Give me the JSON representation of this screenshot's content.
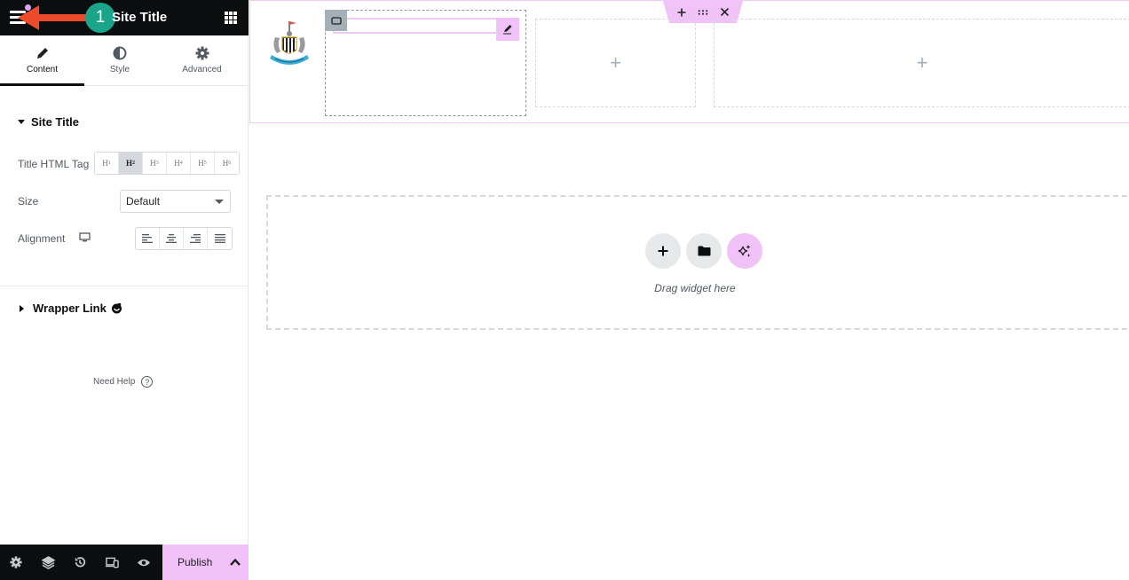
{
  "panel": {
    "title": "Site Title",
    "annotation_step": "1",
    "tabs": [
      {
        "label": "Content",
        "icon": "pencil-icon",
        "active": true
      },
      {
        "label": "Style",
        "icon": "half-circle-icon",
        "active": false
      },
      {
        "label": "Advanced",
        "icon": "gear-icon",
        "active": false
      }
    ],
    "section_site_title": {
      "heading": "Site Title",
      "title_html_tag_label": "Title HTML Tag",
      "tags": [
        "H1",
        "H2",
        "H3",
        "H4",
        "H5",
        "H6"
      ],
      "selected_tag": "H2",
      "size_label": "Size",
      "size_value": "Default",
      "alignment_label": "Alignment",
      "alignment_options": [
        "left",
        "center",
        "right",
        "justify"
      ]
    },
    "section_wrapper_link": {
      "heading": "Wrapper Link",
      "badge_icon": "pro-icon"
    },
    "need_help": "Need Help",
    "footer": {
      "icons": [
        "gear-icon",
        "layers-icon",
        "history-icon",
        "responsive-icon",
        "eye-icon"
      ],
      "publish_label": "Publish"
    }
  },
  "canvas": {
    "section_controls": [
      "add",
      "drag",
      "delete"
    ],
    "drop_zone_text": "Drag widget here",
    "drop_buttons": [
      "add-icon",
      "folder-icon",
      "ai-sparkle-icon"
    ]
  },
  "colors": {
    "accent_pink": "#f0c2f7",
    "header_dark": "#0c0d0e",
    "annotation_arrow": "#ee4b2b",
    "annotation_badge": "#1aa58b"
  }
}
